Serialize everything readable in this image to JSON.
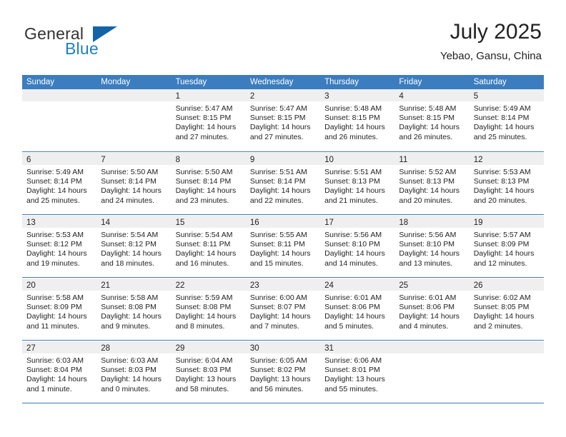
{
  "brand": {
    "word_general": "General",
    "word_blue": "Blue",
    "flag_icon": "blue-triangle-flag-icon"
  },
  "header": {
    "month_title": "July 2025",
    "location": "Yebao, Gansu, China"
  },
  "colors": {
    "header_blue": "#3b7dbf",
    "brand_blue": "#1f7fc4",
    "flag_blue": "#1464a5",
    "day_band_gray": "#efefef",
    "text": "#222222"
  },
  "calendar": {
    "weekdays": [
      "Sunday",
      "Monday",
      "Tuesday",
      "Wednesday",
      "Thursday",
      "Friday",
      "Saturday"
    ],
    "weeks": [
      [
        {
          "day": "",
          "lines": []
        },
        {
          "day": "",
          "lines": []
        },
        {
          "day": "1",
          "lines": [
            "Sunrise: 5:47 AM",
            "Sunset: 8:15 PM",
            "Daylight: 14 hours",
            "and 27 minutes."
          ]
        },
        {
          "day": "2",
          "lines": [
            "Sunrise: 5:47 AM",
            "Sunset: 8:15 PM",
            "Daylight: 14 hours",
            "and 27 minutes."
          ]
        },
        {
          "day": "3",
          "lines": [
            "Sunrise: 5:48 AM",
            "Sunset: 8:15 PM",
            "Daylight: 14 hours",
            "and 26 minutes."
          ]
        },
        {
          "day": "4",
          "lines": [
            "Sunrise: 5:48 AM",
            "Sunset: 8:15 PM",
            "Daylight: 14 hours",
            "and 26 minutes."
          ]
        },
        {
          "day": "5",
          "lines": [
            "Sunrise: 5:49 AM",
            "Sunset: 8:14 PM",
            "Daylight: 14 hours",
            "and 25 minutes."
          ]
        }
      ],
      [
        {
          "day": "6",
          "lines": [
            "Sunrise: 5:49 AM",
            "Sunset: 8:14 PM",
            "Daylight: 14 hours",
            "and 25 minutes."
          ]
        },
        {
          "day": "7",
          "lines": [
            "Sunrise: 5:50 AM",
            "Sunset: 8:14 PM",
            "Daylight: 14 hours",
            "and 24 minutes."
          ]
        },
        {
          "day": "8",
          "lines": [
            "Sunrise: 5:50 AM",
            "Sunset: 8:14 PM",
            "Daylight: 14 hours",
            "and 23 minutes."
          ]
        },
        {
          "day": "9",
          "lines": [
            "Sunrise: 5:51 AM",
            "Sunset: 8:14 PM",
            "Daylight: 14 hours",
            "and 22 minutes."
          ]
        },
        {
          "day": "10",
          "lines": [
            "Sunrise: 5:51 AM",
            "Sunset: 8:13 PM",
            "Daylight: 14 hours",
            "and 21 minutes."
          ]
        },
        {
          "day": "11",
          "lines": [
            "Sunrise: 5:52 AM",
            "Sunset: 8:13 PM",
            "Daylight: 14 hours",
            "and 20 minutes."
          ]
        },
        {
          "day": "12",
          "lines": [
            "Sunrise: 5:53 AM",
            "Sunset: 8:13 PM",
            "Daylight: 14 hours",
            "and 20 minutes."
          ]
        }
      ],
      [
        {
          "day": "13",
          "lines": [
            "Sunrise: 5:53 AM",
            "Sunset: 8:12 PM",
            "Daylight: 14 hours",
            "and 19 minutes."
          ]
        },
        {
          "day": "14",
          "lines": [
            "Sunrise: 5:54 AM",
            "Sunset: 8:12 PM",
            "Daylight: 14 hours",
            "and 18 minutes."
          ]
        },
        {
          "day": "15",
          "lines": [
            "Sunrise: 5:54 AM",
            "Sunset: 8:11 PM",
            "Daylight: 14 hours",
            "and 16 minutes."
          ]
        },
        {
          "day": "16",
          "lines": [
            "Sunrise: 5:55 AM",
            "Sunset: 8:11 PM",
            "Daylight: 14 hours",
            "and 15 minutes."
          ]
        },
        {
          "day": "17",
          "lines": [
            "Sunrise: 5:56 AM",
            "Sunset: 8:10 PM",
            "Daylight: 14 hours",
            "and 14 minutes."
          ]
        },
        {
          "day": "18",
          "lines": [
            "Sunrise: 5:56 AM",
            "Sunset: 8:10 PM",
            "Daylight: 14 hours",
            "and 13 minutes."
          ]
        },
        {
          "day": "19",
          "lines": [
            "Sunrise: 5:57 AM",
            "Sunset: 8:09 PM",
            "Daylight: 14 hours",
            "and 12 minutes."
          ]
        }
      ],
      [
        {
          "day": "20",
          "lines": [
            "Sunrise: 5:58 AM",
            "Sunset: 8:09 PM",
            "Daylight: 14 hours",
            "and 11 minutes."
          ]
        },
        {
          "day": "21",
          "lines": [
            "Sunrise: 5:58 AM",
            "Sunset: 8:08 PM",
            "Daylight: 14 hours",
            "and 9 minutes."
          ]
        },
        {
          "day": "22",
          "lines": [
            "Sunrise: 5:59 AM",
            "Sunset: 8:08 PM",
            "Daylight: 14 hours",
            "and 8 minutes."
          ]
        },
        {
          "day": "23",
          "lines": [
            "Sunrise: 6:00 AM",
            "Sunset: 8:07 PM",
            "Daylight: 14 hours",
            "and 7 minutes."
          ]
        },
        {
          "day": "24",
          "lines": [
            "Sunrise: 6:01 AM",
            "Sunset: 8:06 PM",
            "Daylight: 14 hours",
            "and 5 minutes."
          ]
        },
        {
          "day": "25",
          "lines": [
            "Sunrise: 6:01 AM",
            "Sunset: 8:06 PM",
            "Daylight: 14 hours",
            "and 4 minutes."
          ]
        },
        {
          "day": "26",
          "lines": [
            "Sunrise: 6:02 AM",
            "Sunset: 8:05 PM",
            "Daylight: 14 hours",
            "and 2 minutes."
          ]
        }
      ],
      [
        {
          "day": "27",
          "lines": [
            "Sunrise: 6:03 AM",
            "Sunset: 8:04 PM",
            "Daylight: 14 hours",
            "and 1 minute."
          ]
        },
        {
          "day": "28",
          "lines": [
            "Sunrise: 6:03 AM",
            "Sunset: 8:03 PM",
            "Daylight: 14 hours",
            "and 0 minutes."
          ]
        },
        {
          "day": "29",
          "lines": [
            "Sunrise: 6:04 AM",
            "Sunset: 8:03 PM",
            "Daylight: 13 hours",
            "and 58 minutes."
          ]
        },
        {
          "day": "30",
          "lines": [
            "Sunrise: 6:05 AM",
            "Sunset: 8:02 PM",
            "Daylight: 13 hours",
            "and 56 minutes."
          ]
        },
        {
          "day": "31",
          "lines": [
            "Sunrise: 6:06 AM",
            "Sunset: 8:01 PM",
            "Daylight: 13 hours",
            "and 55 minutes."
          ]
        },
        {
          "day": "",
          "lines": []
        },
        {
          "day": "",
          "lines": []
        }
      ]
    ]
  }
}
